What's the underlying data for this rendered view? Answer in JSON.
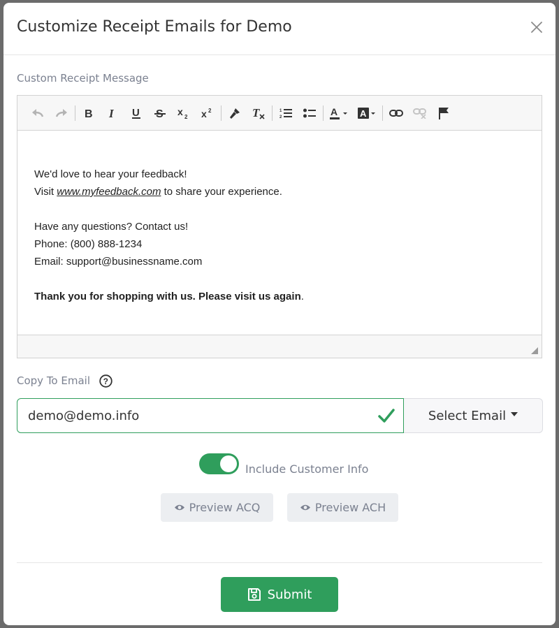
{
  "modal": {
    "title": "Customize Receipt Emails for Demo"
  },
  "editor": {
    "label": "Custom Receipt Message",
    "toolbar": [
      "undo-icon",
      "redo-icon",
      "bold-icon",
      "italic-icon",
      "underline-icon",
      "strikethrough-icon",
      "subscript-icon",
      "superscript-icon",
      "format-painter-icon",
      "clear-format-icon",
      "numbered-list-icon",
      "bulleted-list-icon",
      "text-color-icon",
      "background-color-icon",
      "link-icon",
      "unlink-icon",
      "flag-icon"
    ],
    "lines": {
      "feedback": "We'd love to hear your feedback!",
      "visit_prefix": "Visit ",
      "visit_link": "www.myfeedback.com",
      "visit_suffix": " to share your experience.",
      "questions": "Have any questions? Contact us!",
      "phone": "Phone: (800) 888-1234",
      "email": "Email: support@businessname.com",
      "thanks_bold": "Thank you for shopping with us. Please visit us again",
      "thanks_end": "."
    }
  },
  "copy_email": {
    "label": "Copy To Email",
    "value": "demo@demo.info",
    "select_label": "Select Email"
  },
  "toggle": {
    "label": "Include Customer Info",
    "on": true
  },
  "preview": {
    "acq_label": "Preview ACQ",
    "ach_label": "Preview ACH"
  },
  "submit": {
    "label": "Submit"
  },
  "colors": {
    "accent": "#2f9e5c",
    "muted_text": "#7b8190"
  }
}
